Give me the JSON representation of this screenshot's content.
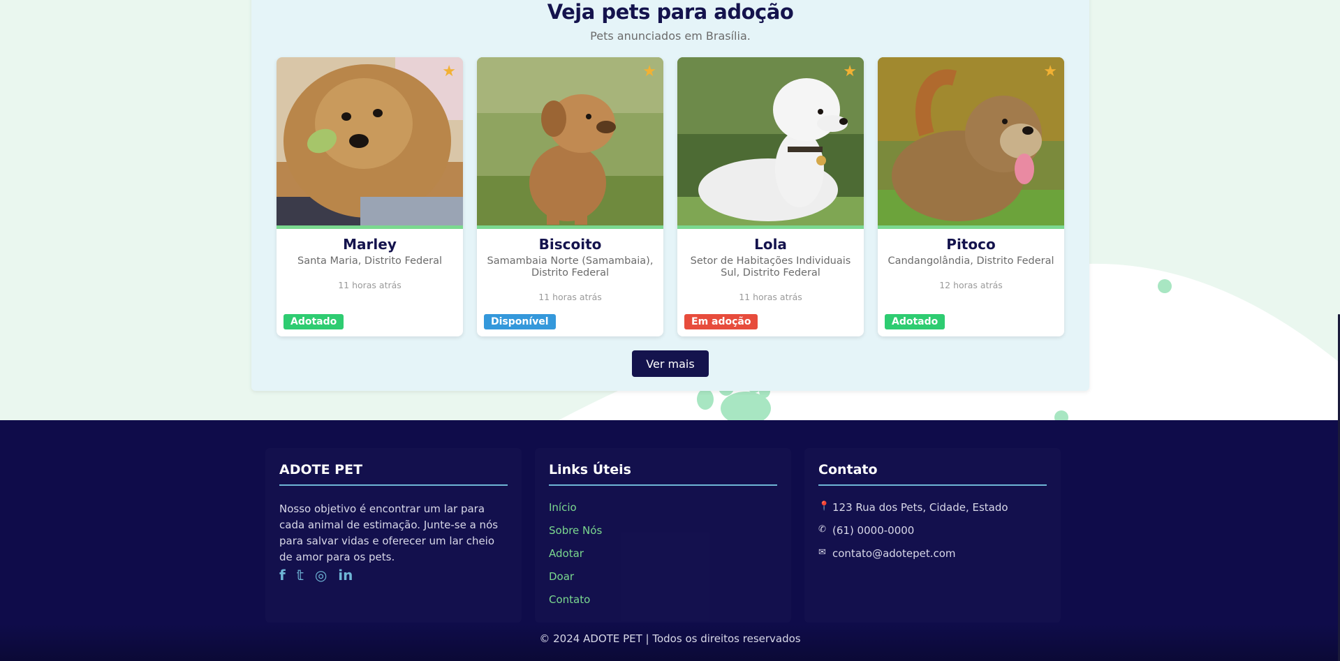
{
  "section": {
    "title": "Veja pets para adoção",
    "subtitle": "Pets anunciados em Brasília."
  },
  "pets": [
    {
      "name": "Marley",
      "location": "Santa Maria, Distrito Federal",
      "time": "11 horas atrás",
      "status": "Adotado",
      "status_color": "#2ecc71",
      "icon": "star-icon"
    },
    {
      "name": "Biscoito",
      "location": "Samambaia Norte (Samambaia), Distrito Federal",
      "time": "11 horas atrás",
      "status": "Disponível",
      "status_color": "#3498db",
      "icon": "star-icon"
    },
    {
      "name": "Lola",
      "location": "Setor de Habitações Individuais Sul, Distrito Federal",
      "time": "11 horas atrás",
      "status": "Em adoção",
      "status_color": "#e74c3c",
      "icon": "star-icon"
    },
    {
      "name": "Pitoco",
      "location": "Candangolândia, Distrito Federal",
      "time": "12 horas atrás",
      "status": "Adotado",
      "status_color": "#2ecc71",
      "icon": "star-icon"
    }
  ],
  "more_button": "Ver mais",
  "footer": {
    "about": {
      "heading": "ADOTE PET",
      "text": "Nosso objetivo é encontrar um lar para cada animal de estimação. Junte-se a nós para salvar vidas e oferecer um lar cheio de amor para os pets.",
      "social": [
        "facebook-icon",
        "twitter-icon",
        "instagram-icon",
        "linkedin-icon"
      ]
    },
    "links": {
      "heading": "Links Úteis",
      "items": [
        "Início",
        "Sobre Nós",
        "Adotar",
        "Doar",
        "Contato"
      ]
    },
    "contact": {
      "heading": "Contato",
      "address": "123 Rua dos Pets, Cidade, Estado",
      "phone": "(61) 0000-0000",
      "email": "contato@adotepet.com"
    },
    "copyright": "© 2024 ADOTE PET | Todos os direitos reservados"
  },
  "colors": {
    "navy": "#14134d",
    "footer_bg": "#0f0c4a",
    "accent_green": "#7bd88f",
    "accent_blue": "#6fb6d6",
    "star": "#f2b134"
  }
}
